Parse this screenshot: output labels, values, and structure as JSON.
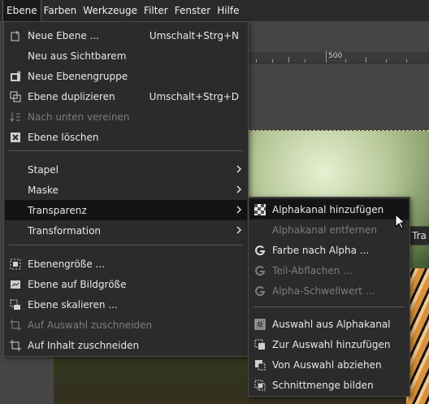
{
  "menubar": {
    "items": [
      "Ebene",
      "Farben",
      "Werkzeuge",
      "Filter",
      "Fenster",
      "Hilfe"
    ]
  },
  "ruler": {
    "label": "500"
  },
  "tooltip_fragment": "Tra",
  "menu": {
    "new_layer": "Neue Ebene ...",
    "new_layer_shortcut": "Umschalt+Strg+N",
    "new_from_visible": "Neu aus Sichtbarem",
    "new_layer_group": "Neue Ebenengruppe",
    "duplicate_layer": "Ebene duplizieren",
    "duplicate_shortcut": "Umschalt+Strg+D",
    "merge_down": "Nach unten vereinen",
    "delete_layer": "Ebene löschen",
    "stack": "Stapel",
    "mask": "Maske",
    "transparency": "Transparenz",
    "transform": "Transformation",
    "layer_boundary_size": "Ebenengröße ...",
    "layer_to_image_size": "Ebene auf Bildgröße",
    "scale_layer": "Ebene skalieren ...",
    "crop_to_selection": "Auf Auswahl zuschneiden",
    "crop_to_content": "Auf Inhalt zuschneiden"
  },
  "submenu": {
    "add_alpha": "Alphakanal hinzufügen",
    "remove_alpha": "Alphakanal entfernen",
    "color_to_alpha": "Farbe nach Alpha ...",
    "semi_flatten": "Teil-Abflachen ...",
    "threshold_alpha": "Alpha-Schwellwert ...",
    "alpha_to_selection": "Auswahl aus Alphakanal",
    "add_to_selection": "Zur Auswahl hinzufügen",
    "subtract_from_selection": "Von Auswahl abziehen",
    "intersect_with_selection": "Schnittmenge bilden"
  }
}
